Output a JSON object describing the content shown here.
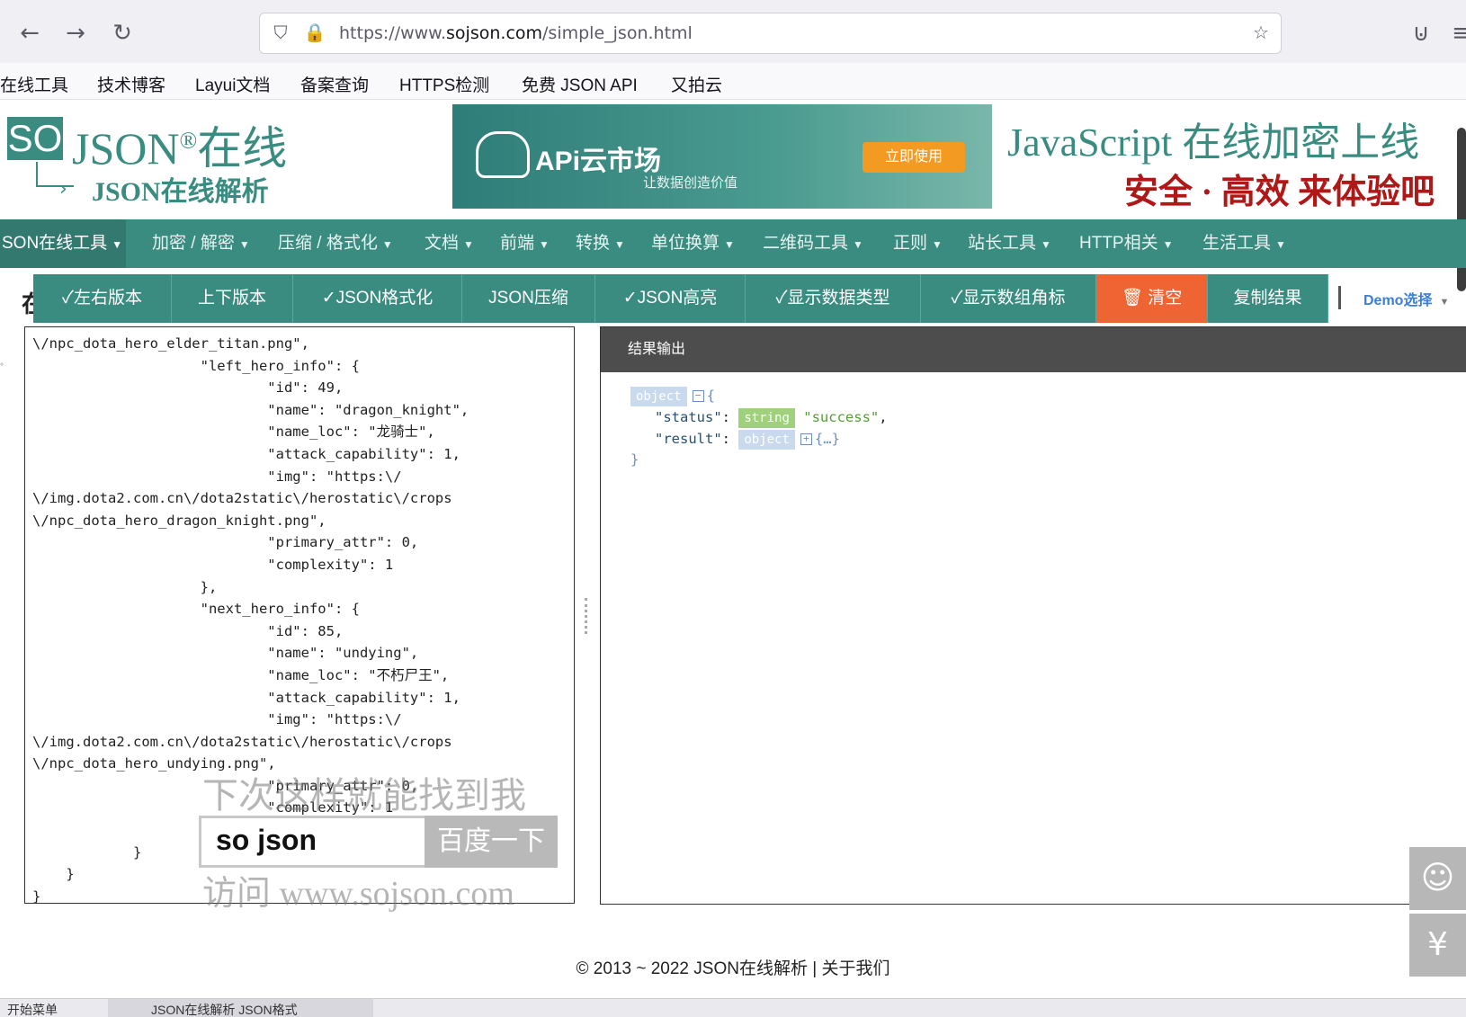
{
  "browser": {
    "url_prefix": "https://www.",
    "url_domain": "sojson.com",
    "url_path": "/simple_json.html",
    "bookmarks": [
      "在线工具",
      "技术博客",
      "Layui文档",
      "备案查询",
      "HTTPS检测",
      "免费 JSON API",
      "又拍云"
    ]
  },
  "header": {
    "logo_box": "SO",
    "logo_json": "JSON",
    "logo_reg": "®",
    "logo_online": "在线",
    "logo_sub": "JSON在线解析",
    "banner_title": "APi云市场",
    "banner_sub": "让数据创造价值",
    "banner_btn": "立即使用",
    "promo_line1": "JavaScript 在线加密上线",
    "promo_line2": "安全 · 高效  来体验吧"
  },
  "mainnav": [
    {
      "label": "SON在线工具"
    },
    {
      "label": "加密 / 解密"
    },
    {
      "label": "压缩 / 格式化"
    },
    {
      "label": "文档"
    },
    {
      "label": "前端"
    },
    {
      "label": "转换"
    },
    {
      "label": "单位换算"
    },
    {
      "label": "二维码工具"
    },
    {
      "label": "正则"
    },
    {
      "label": "站长工具"
    },
    {
      "label": "HTTP相关"
    },
    {
      "label": "生活工具"
    }
  ],
  "actions": {
    "title_char": "在",
    "buttons": [
      "✓左右版本",
      "上下版本",
      "✓JSON格式化",
      "JSON压缩",
      "✓JSON高亮",
      "✓显示数据类型",
      "✓显示数组角标",
      "🗑 清空",
      "复制结果"
    ],
    "demo": "Demo选择"
  },
  "editor": {
    "content": "\\/npc_dota_hero_elder_titan.png\",\n                    \"left_hero_info\": {\n                            \"id\": 49,\n                            \"name\": \"dragon_knight\",\n                            \"name_loc\": \"龙骑士\",\n                            \"attack_capability\": 1,\n                            \"img\": \"https:\\/\n\\/img.dota2.com.cn\\/dota2static\\/herostatic\\/crops\n\\/npc_dota_hero_dragon_knight.png\",\n                            \"primary_attr\": 0,\n                            \"complexity\": 1\n                    },\n                    \"next_hero_info\": {\n                            \"id\": 85,\n                            \"name\": \"undying\",\n                            \"name_loc\": \"不朽尸王\",\n                            \"attack_capability\": 1,\n                            \"img\": \"https:\\/\n\\/img.dota2.com.cn\\/dota2static\\/herostatic\\/crops\n\\/npc_dota_hero_undying.png\",\n                            \"primary_attr\": 0,\n                            \"complexity\": 1\n                    }\n            }\n    }\n}"
  },
  "result": {
    "title": "结果输出",
    "root_type": "object",
    "open_brace": "{",
    "status_key": "\"status\"",
    "status_type": "string",
    "status_value": "\"success\"",
    "result_key": "\"result\"",
    "result_type": "object",
    "result_collapsed": "{…}",
    "close_brace": "}"
  },
  "watermark": {
    "line1": "下次这样就能找到我",
    "search_text": "so json",
    "search_btn": "百度一下",
    "line3": "访问 www.sojson.com"
  },
  "footer": {
    "text": "© 2013 ~ 2022 JSON在线解析 | 关于我们"
  },
  "taskbar": {
    "start_item": "开始菜单",
    "window_item": "JSON在线解析 JSON格式"
  }
}
